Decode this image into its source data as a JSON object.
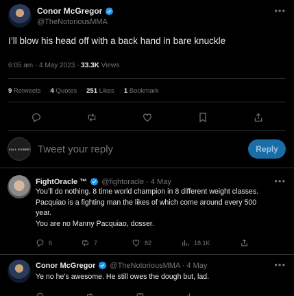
{
  "main_tweet": {
    "author_name": "Conor McGregor",
    "author_handle": "@TheNotoriousMMA",
    "text": "I’ll blow his head off with a back hand in bare knuckle",
    "time": "6:05 am · 4 May 2023 · ",
    "views_count": "33.3K",
    "views_label": " Views",
    "stats": {
      "retweets_count": "9",
      "retweets_label": " Retweets",
      "quotes_count": "4",
      "quotes_label": " Quotes",
      "likes_count": "251",
      "likes_label": " Likes",
      "bookmarks_count": "1",
      "bookmarks_label": " Bookmark"
    }
  },
  "composer": {
    "avatar_text": "CALL KICKER",
    "placeholder": "Tweet your reply",
    "reply_button": "Reply"
  },
  "replies": [
    {
      "author_name": "FightOracle ™",
      "author_handle": "@fightoracle · 4 May",
      "lines": [
        "You’ll do nothing. 8 time world champion in 8 different weight classes.",
        "Pacquiao is a fighting man the likes of which come around every 500",
        "year.",
        "You are no Manny Pacquiao, dosser."
      ],
      "replies_count": "6",
      "retweets_count": "7",
      "likes_count": "82",
      "views_count": "18.1K"
    },
    {
      "author_name": "Conor McGregor",
      "author_handle": "@TheNotoriousMMA · 4 May",
      "text": "Ye no he's awesome. He still owes the dough but, lad."
    }
  ],
  "colors": {
    "background": "#000000",
    "text_primary": "#e7e9ea",
    "text_secondary": "#71767b",
    "divider": "#2f3336",
    "verified": "#1d9bf0",
    "reply_button_bg": "#1a6ea8"
  }
}
